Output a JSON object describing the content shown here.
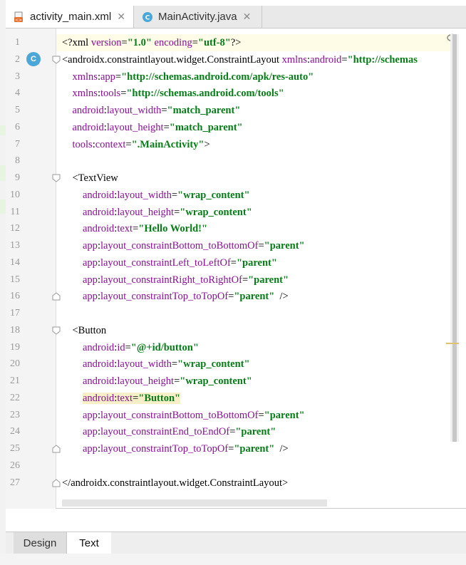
{
  "tabs": [
    {
      "label": "activity_main.xml",
      "icon": "xml-file-icon",
      "active": true
    },
    {
      "label": "MainActivity.java",
      "icon": "java-class-icon",
      "active": false
    }
  ],
  "gutter_badge": "C",
  "lines": [
    {
      "n": "1",
      "tokens": [
        {
          "t": "<?",
          "c": "pi"
        },
        {
          "t": "xml ",
          "c": "tg"
        },
        {
          "t": "version",
          "c": "ns"
        },
        {
          "t": "=",
          "c": "tg"
        },
        {
          "t": "\"1.0\"",
          "c": "av"
        },
        {
          "t": " ",
          "c": "tg"
        },
        {
          "t": "encoding",
          "c": "ns"
        },
        {
          "t": "=",
          "c": "tg"
        },
        {
          "t": "\"utf-8\"",
          "c": "av"
        },
        {
          "t": "?>",
          "c": "pi"
        }
      ]
    },
    {
      "n": "2",
      "tokens": [
        {
          "t": "<androidx.constraintlayout.widget.ConstraintLayout ",
          "c": "tg"
        },
        {
          "t": "xmlns",
          "c": "ns"
        },
        {
          "t": ":",
          "c": "tg"
        },
        {
          "t": "android",
          "c": "ns"
        },
        {
          "t": "=",
          "c": "tg"
        },
        {
          "t": "\"http://schemas",
          "c": "av"
        }
      ]
    },
    {
      "n": "3",
      "tokens": [
        {
          "t": "    xmlns",
          "c": "ns"
        },
        {
          "t": ":",
          "c": "tg"
        },
        {
          "t": "app",
          "c": "ns"
        },
        {
          "t": "=",
          "c": "tg"
        },
        {
          "t": "\"http://schemas.android.com/apk/res-auto\"",
          "c": "av"
        }
      ]
    },
    {
      "n": "4",
      "tokens": [
        {
          "t": "    xmlns",
          "c": "ns"
        },
        {
          "t": ":",
          "c": "tg"
        },
        {
          "t": "tools",
          "c": "ns"
        },
        {
          "t": "=",
          "c": "tg"
        },
        {
          "t": "\"http://schemas.android.com/tools\"",
          "c": "av"
        }
      ]
    },
    {
      "n": "5",
      "tokens": [
        {
          "t": "    android",
          "c": "ns"
        },
        {
          "t": ":",
          "c": "tg"
        },
        {
          "t": "layout_width",
          "c": "ns"
        },
        {
          "t": "=",
          "c": "tg"
        },
        {
          "t": "\"match_parent\"",
          "c": "av"
        }
      ]
    },
    {
      "n": "6",
      "tokens": [
        {
          "t": "    android",
          "c": "ns"
        },
        {
          "t": ":",
          "c": "tg"
        },
        {
          "t": "layout_height",
          "c": "ns"
        },
        {
          "t": "=",
          "c": "tg"
        },
        {
          "t": "\"match_parent\"",
          "c": "av"
        }
      ]
    },
    {
      "n": "7",
      "tokens": [
        {
          "t": "    tools",
          "c": "ns"
        },
        {
          "t": ":",
          "c": "tg"
        },
        {
          "t": "context",
          "c": "ns"
        },
        {
          "t": "=",
          "c": "tg"
        },
        {
          "t": "\".MainActivity\"",
          "c": "av"
        },
        {
          "t": ">",
          "c": "tg"
        }
      ]
    },
    {
      "n": "8",
      "tokens": []
    },
    {
      "n": "9",
      "tokens": [
        {
          "t": "    <TextView",
          "c": "tg"
        }
      ]
    },
    {
      "n": "10",
      "tokens": [
        {
          "t": "        android",
          "c": "ns"
        },
        {
          "t": ":",
          "c": "tg"
        },
        {
          "t": "layout_width",
          "c": "ns"
        },
        {
          "t": "=",
          "c": "tg"
        },
        {
          "t": "\"wrap_content\"",
          "c": "av"
        }
      ]
    },
    {
      "n": "11",
      "tokens": [
        {
          "t": "        android",
          "c": "ns"
        },
        {
          "t": ":",
          "c": "tg"
        },
        {
          "t": "layout_height",
          "c": "ns"
        },
        {
          "t": "=",
          "c": "tg"
        },
        {
          "t": "\"wrap_content\"",
          "c": "av"
        }
      ]
    },
    {
      "n": "12",
      "tokens": [
        {
          "t": "        android",
          "c": "ns"
        },
        {
          "t": ":",
          "c": "tg"
        },
        {
          "t": "text",
          "c": "ns"
        },
        {
          "t": "=",
          "c": "tg"
        },
        {
          "t": "\"Hello World!\"",
          "c": "av"
        }
      ]
    },
    {
      "n": "13",
      "tokens": [
        {
          "t": "        app",
          "c": "ns"
        },
        {
          "t": ":",
          "c": "tg"
        },
        {
          "t": "layout_constraintBottom_toBottomOf",
          "c": "ns"
        },
        {
          "t": "=",
          "c": "tg"
        },
        {
          "t": "\"parent\"",
          "c": "av"
        }
      ]
    },
    {
      "n": "14",
      "tokens": [
        {
          "t": "        app",
          "c": "ns"
        },
        {
          "t": ":",
          "c": "tg"
        },
        {
          "t": "layout_constraintLeft_toLeftOf",
          "c": "ns"
        },
        {
          "t": "=",
          "c": "tg"
        },
        {
          "t": "\"parent\"",
          "c": "av"
        }
      ]
    },
    {
      "n": "15",
      "tokens": [
        {
          "t": "        app",
          "c": "ns"
        },
        {
          "t": ":",
          "c": "tg"
        },
        {
          "t": "layout_constraintRight_toRightOf",
          "c": "ns"
        },
        {
          "t": "=",
          "c": "tg"
        },
        {
          "t": "\"parent\"",
          "c": "av"
        }
      ]
    },
    {
      "n": "16",
      "tokens": [
        {
          "t": "        app",
          "c": "ns"
        },
        {
          "t": ":",
          "c": "tg"
        },
        {
          "t": "layout_constraintTop_toTopOf",
          "c": "ns"
        },
        {
          "t": "=",
          "c": "tg"
        },
        {
          "t": "\"parent\"",
          "c": "av"
        },
        {
          "t": "  />",
          "c": "tg"
        }
      ]
    },
    {
      "n": "17",
      "tokens": []
    },
    {
      "n": "18",
      "tokens": [
        {
          "t": "    <Button",
          "c": "tg"
        }
      ]
    },
    {
      "n": "19",
      "tokens": [
        {
          "t": "        android",
          "c": "ns"
        },
        {
          "t": ":",
          "c": "tg"
        },
        {
          "t": "id",
          "c": "ns"
        },
        {
          "t": "=",
          "c": "tg"
        },
        {
          "t": "\"@+id/button\"",
          "c": "av"
        }
      ]
    },
    {
      "n": "20",
      "tokens": [
        {
          "t": "        android",
          "c": "ns"
        },
        {
          "t": ":",
          "c": "tg"
        },
        {
          "t": "layout_width",
          "c": "ns"
        },
        {
          "t": "=",
          "c": "tg"
        },
        {
          "t": "\"wrap_content\"",
          "c": "av"
        }
      ]
    },
    {
      "n": "21",
      "tokens": [
        {
          "t": "        android",
          "c": "ns"
        },
        {
          "t": ":",
          "c": "tg"
        },
        {
          "t": "layout_height",
          "c": "ns"
        },
        {
          "t": "=",
          "c": "tg"
        },
        {
          "t": "\"wrap_content\"",
          "c": "av"
        }
      ]
    },
    {
      "n": "22",
      "tokens": [
        {
          "t": "        ",
          "c": "tg"
        },
        {
          "t": "android",
          "c": "ns hl"
        },
        {
          "t": ":",
          "c": "tg hl"
        },
        {
          "t": "text",
          "c": "ns hl"
        },
        {
          "t": "=",
          "c": "tg hl"
        },
        {
          "t": "\"Button\"",
          "c": "av hl"
        }
      ]
    },
    {
      "n": "23",
      "tokens": [
        {
          "t": "        app",
          "c": "ns"
        },
        {
          "t": ":",
          "c": "tg"
        },
        {
          "t": "layout_constraintBottom_toBottomOf",
          "c": "ns"
        },
        {
          "t": "=",
          "c": "tg"
        },
        {
          "t": "\"parent\"",
          "c": "av"
        }
      ]
    },
    {
      "n": "24",
      "tokens": [
        {
          "t": "        app",
          "c": "ns"
        },
        {
          "t": ":",
          "c": "tg"
        },
        {
          "t": "layout_constraintEnd_toEndOf",
          "c": "ns"
        },
        {
          "t": "=",
          "c": "tg"
        },
        {
          "t": "\"parent\"",
          "c": "av"
        }
      ]
    },
    {
      "n": "25",
      "tokens": [
        {
          "t": "        app",
          "c": "ns"
        },
        {
          "t": ":",
          "c": "tg"
        },
        {
          "t": "layout_constraintTop_toTopOf",
          "c": "ns"
        },
        {
          "t": "=",
          "c": "tg"
        },
        {
          "t": "\"parent\"",
          "c": "av"
        },
        {
          "t": "  />",
          "c": "tg"
        }
      ]
    },
    {
      "n": "26",
      "tokens": []
    },
    {
      "n": "27",
      "tokens": [
        {
          "t": "</androidx.constraintlayout.widget.ConstraintLayout>",
          "c": "tg"
        }
      ]
    }
  ],
  "bottom_tabs": {
    "design": "Design",
    "text": "Text"
  },
  "colors": {
    "attribute": "#871094",
    "value": "#067d17",
    "current_line": "#fefbe6",
    "badge": "#4aa7d8"
  }
}
